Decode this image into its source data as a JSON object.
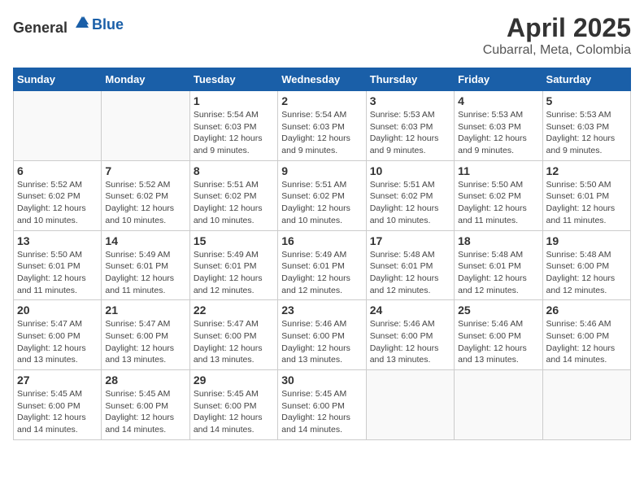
{
  "header": {
    "logo": {
      "general": "General",
      "blue": "Blue"
    },
    "title": "April 2025",
    "location": "Cubarral, Meta, Colombia"
  },
  "weekdays": [
    "Sunday",
    "Monday",
    "Tuesday",
    "Wednesday",
    "Thursday",
    "Friday",
    "Saturday"
  ],
  "weeks": [
    [
      {
        "day": "",
        "info": ""
      },
      {
        "day": "",
        "info": ""
      },
      {
        "day": "1",
        "info": "Sunrise: 5:54 AM\nSunset: 6:03 PM\nDaylight: 12 hours and 9 minutes."
      },
      {
        "day": "2",
        "info": "Sunrise: 5:54 AM\nSunset: 6:03 PM\nDaylight: 12 hours and 9 minutes."
      },
      {
        "day": "3",
        "info": "Sunrise: 5:53 AM\nSunset: 6:03 PM\nDaylight: 12 hours and 9 minutes."
      },
      {
        "day": "4",
        "info": "Sunrise: 5:53 AM\nSunset: 6:03 PM\nDaylight: 12 hours and 9 minutes."
      },
      {
        "day": "5",
        "info": "Sunrise: 5:53 AM\nSunset: 6:03 PM\nDaylight: 12 hours and 9 minutes."
      }
    ],
    [
      {
        "day": "6",
        "info": "Sunrise: 5:52 AM\nSunset: 6:02 PM\nDaylight: 12 hours and 10 minutes."
      },
      {
        "day": "7",
        "info": "Sunrise: 5:52 AM\nSunset: 6:02 PM\nDaylight: 12 hours and 10 minutes."
      },
      {
        "day": "8",
        "info": "Sunrise: 5:51 AM\nSunset: 6:02 PM\nDaylight: 12 hours and 10 minutes."
      },
      {
        "day": "9",
        "info": "Sunrise: 5:51 AM\nSunset: 6:02 PM\nDaylight: 12 hours and 10 minutes."
      },
      {
        "day": "10",
        "info": "Sunrise: 5:51 AM\nSunset: 6:02 PM\nDaylight: 12 hours and 10 minutes."
      },
      {
        "day": "11",
        "info": "Sunrise: 5:50 AM\nSunset: 6:02 PM\nDaylight: 12 hours and 11 minutes."
      },
      {
        "day": "12",
        "info": "Sunrise: 5:50 AM\nSunset: 6:01 PM\nDaylight: 12 hours and 11 minutes."
      }
    ],
    [
      {
        "day": "13",
        "info": "Sunrise: 5:50 AM\nSunset: 6:01 PM\nDaylight: 12 hours and 11 minutes."
      },
      {
        "day": "14",
        "info": "Sunrise: 5:49 AM\nSunset: 6:01 PM\nDaylight: 12 hours and 11 minutes."
      },
      {
        "day": "15",
        "info": "Sunrise: 5:49 AM\nSunset: 6:01 PM\nDaylight: 12 hours and 12 minutes."
      },
      {
        "day": "16",
        "info": "Sunrise: 5:49 AM\nSunset: 6:01 PM\nDaylight: 12 hours and 12 minutes."
      },
      {
        "day": "17",
        "info": "Sunrise: 5:48 AM\nSunset: 6:01 PM\nDaylight: 12 hours and 12 minutes."
      },
      {
        "day": "18",
        "info": "Sunrise: 5:48 AM\nSunset: 6:01 PM\nDaylight: 12 hours and 12 minutes."
      },
      {
        "day": "19",
        "info": "Sunrise: 5:48 AM\nSunset: 6:00 PM\nDaylight: 12 hours and 12 minutes."
      }
    ],
    [
      {
        "day": "20",
        "info": "Sunrise: 5:47 AM\nSunset: 6:00 PM\nDaylight: 12 hours and 13 minutes."
      },
      {
        "day": "21",
        "info": "Sunrise: 5:47 AM\nSunset: 6:00 PM\nDaylight: 12 hours and 13 minutes."
      },
      {
        "day": "22",
        "info": "Sunrise: 5:47 AM\nSunset: 6:00 PM\nDaylight: 12 hours and 13 minutes."
      },
      {
        "day": "23",
        "info": "Sunrise: 5:46 AM\nSunset: 6:00 PM\nDaylight: 12 hours and 13 minutes."
      },
      {
        "day": "24",
        "info": "Sunrise: 5:46 AM\nSunset: 6:00 PM\nDaylight: 12 hours and 13 minutes."
      },
      {
        "day": "25",
        "info": "Sunrise: 5:46 AM\nSunset: 6:00 PM\nDaylight: 12 hours and 13 minutes."
      },
      {
        "day": "26",
        "info": "Sunrise: 5:46 AM\nSunset: 6:00 PM\nDaylight: 12 hours and 14 minutes."
      }
    ],
    [
      {
        "day": "27",
        "info": "Sunrise: 5:45 AM\nSunset: 6:00 PM\nDaylight: 12 hours and 14 minutes."
      },
      {
        "day": "28",
        "info": "Sunrise: 5:45 AM\nSunset: 6:00 PM\nDaylight: 12 hours and 14 minutes."
      },
      {
        "day": "29",
        "info": "Sunrise: 5:45 AM\nSunset: 6:00 PM\nDaylight: 12 hours and 14 minutes."
      },
      {
        "day": "30",
        "info": "Sunrise: 5:45 AM\nSunset: 6:00 PM\nDaylight: 12 hours and 14 minutes."
      },
      {
        "day": "",
        "info": ""
      },
      {
        "day": "",
        "info": ""
      },
      {
        "day": "",
        "info": ""
      }
    ]
  ]
}
